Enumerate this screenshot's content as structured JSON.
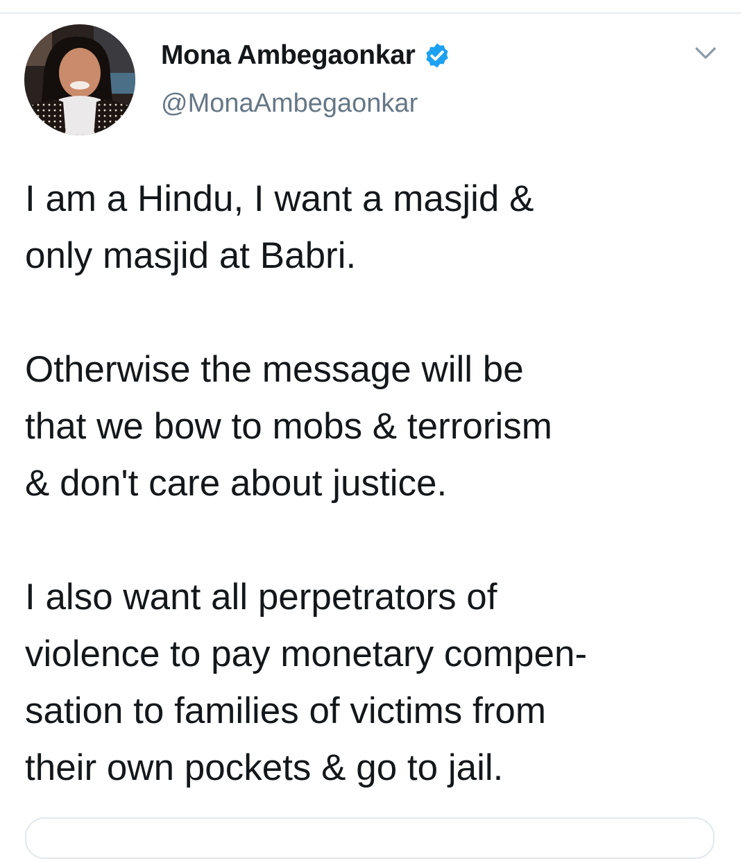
{
  "tweet": {
    "author": {
      "display_name": "Mona Ambegaonkar",
      "handle": "@MonaAmbegaonkar",
      "verified": true,
      "avatar_icon": "profile-photo"
    },
    "menu_icon": "chevron-down-icon",
    "paragraphs": [
      [
        "I am a Hindu, I want a masjid &",
        "only masjid at Babri."
      ],
      [
        "Otherwise the message will be",
        "that we bow to mobs & terrorism",
        "& don't care about justice."
      ],
      [
        "I also want all perpetrators of",
        "violence to pay monetary compen-",
        "sation to families of victims from",
        "their own pockets & go to jail."
      ]
    ]
  },
  "colors": {
    "text_primary": "#14171a",
    "text_secondary": "#657786",
    "verified_blue": "#1da1f2",
    "divider": "#e6ecf0"
  }
}
